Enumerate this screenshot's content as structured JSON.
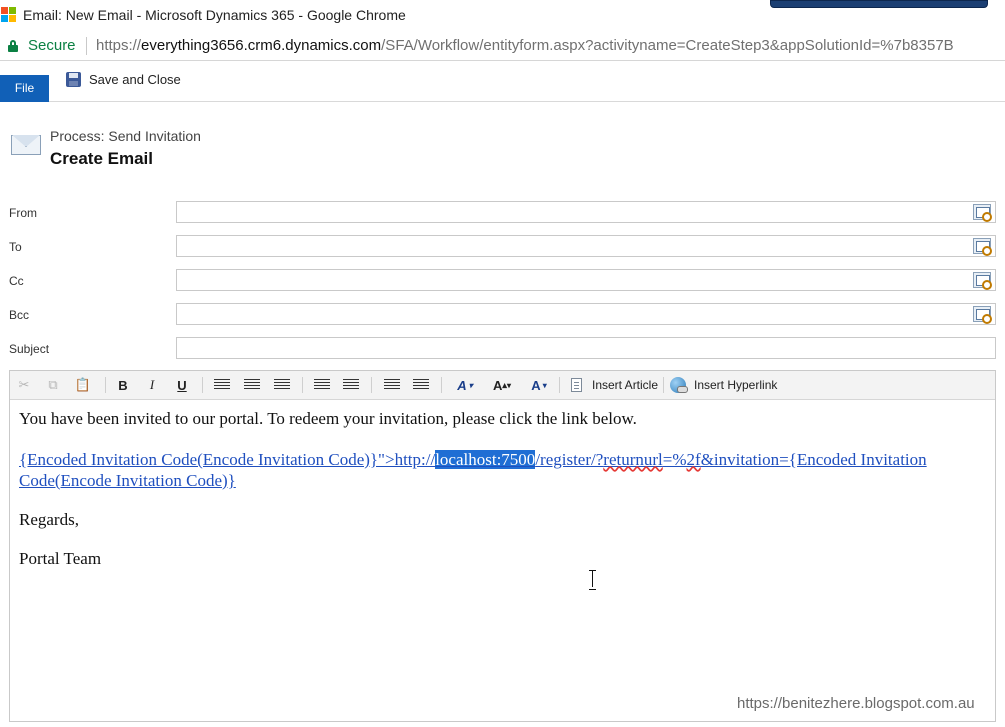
{
  "window": {
    "title": "Email: New Email - Microsoft Dynamics 365 - Google Chrome"
  },
  "address_bar": {
    "secure_label": "Secure",
    "url_scheme": "https://",
    "url_host": "everything3656.crm6.dynamics.com",
    "url_path": "/SFA/Workflow/entityform.aspx?activityname=CreateStep3&appSolutionId=%7b8357B"
  },
  "ribbon": {
    "file_label": "File",
    "save_close_label": "Save and Close"
  },
  "header": {
    "process_label": "Process: Send Invitation",
    "title": "Create Email"
  },
  "form": {
    "from_label": "From",
    "to_label": "To",
    "cc_label": "Cc",
    "bcc_label": "Bcc",
    "subject_label": "Subject",
    "from_value": "",
    "to_value": "",
    "cc_value": "",
    "bcc_value": "",
    "subject_value": ""
  },
  "editor": {
    "toolbar": {
      "bold": "B",
      "italic": "I",
      "underline": "U",
      "font_color": "A",
      "font_size": "A",
      "highlight": "A",
      "insert_article": "Insert Article",
      "insert_hyperlink": "Insert Hyperlink"
    },
    "body": {
      "line1": "You have been invited to our portal. To redeem your invitation, please click the link below.",
      "link_part1": "{Encoded Invitation Code(Encode Invitation Code)}\">http://",
      "link_highlight": "localhost:7500",
      "link_part2": "/register/?",
      "link_squiggle1": "returnurl",
      "link_part3": "=%",
      "link_squiggle2": "2f",
      "link_part4": "&invitation={Encoded Invitation Code(Encode Invitation Code)}",
      "regards": "Regards,",
      "signature": "Portal Team"
    }
  },
  "watermark": "https://benitezhere.blogspot.com.au",
  "colors": {
    "file_button": "#1160b7",
    "secure": "#0b8043",
    "link": "#1f4fbf",
    "selection": "#1f6ed4"
  }
}
